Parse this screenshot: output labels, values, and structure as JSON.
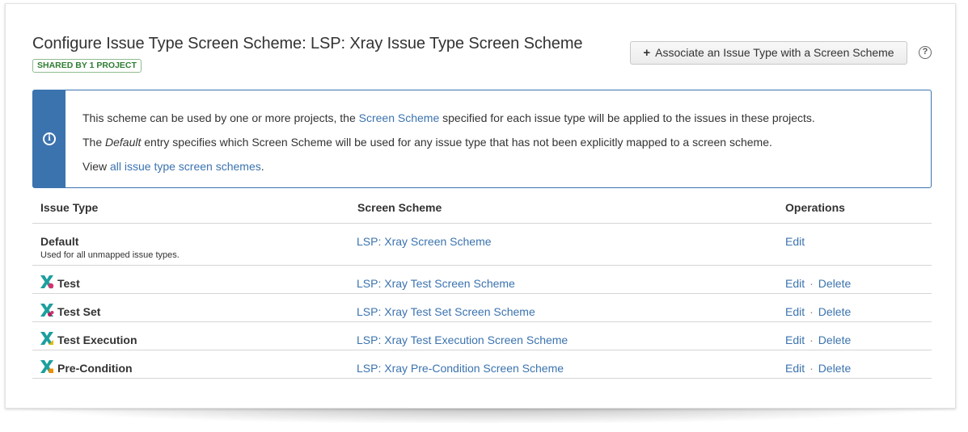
{
  "header": {
    "title": "Configure Issue Type Screen Scheme: LSP: Xray Issue Type Screen Scheme",
    "badge": "SHARED BY 1 PROJECT",
    "associate_button": "Associate an Issue Type with a Screen Scheme",
    "help": "?"
  },
  "info": {
    "line1_pre": "This scheme can be used by one or more projects, the ",
    "line1_link": "Screen Scheme",
    "line1_post": " specified for each issue type will be applied to the issues in these projects.",
    "line2_pre": "The ",
    "line2_em": "Default",
    "line2_post": " entry specifies which Screen Scheme will be used for any issue type that has not been explicitly mapped to a screen scheme.",
    "line3_pre": "View ",
    "line3_link": "all issue type screen schemes",
    "line3_post": "."
  },
  "table": {
    "headers": [
      "Issue Type",
      "Screen Scheme",
      "Operations"
    ],
    "rows": [
      {
        "name": "Default",
        "sub": "Used for all unmapped issue types.",
        "scheme": "LSP: Xray Screen Scheme",
        "edit": "Edit",
        "delete": "",
        "icon_color": ""
      },
      {
        "name": "Test",
        "sub": "",
        "scheme": "LSP: Xray Test Screen Scheme",
        "edit": "Edit",
        "delete": "Delete",
        "icon_color": "#d6336c"
      },
      {
        "name": "Test Set",
        "sub": "",
        "scheme": "LSP: Xray Test Set Screen Scheme",
        "edit": "Edit",
        "delete": "Delete",
        "icon_color": "#c2185b"
      },
      {
        "name": "Test Execution",
        "sub": "",
        "scheme": "LSP: Xray Test Execution Screen Scheme",
        "edit": "Edit",
        "delete": "Delete",
        "icon_color": "#e6b800"
      },
      {
        "name": "Pre-Condition",
        "sub": "",
        "scheme": "LSP: Xray Pre-Condition Screen Scheme",
        "edit": "Edit",
        "delete": "Delete",
        "icon_color": "#f08c00"
      }
    ]
  },
  "colors": {
    "accent": "#3b73af",
    "xray_teal": "#1e9e9e",
    "badge_green": "#2e7d32"
  }
}
